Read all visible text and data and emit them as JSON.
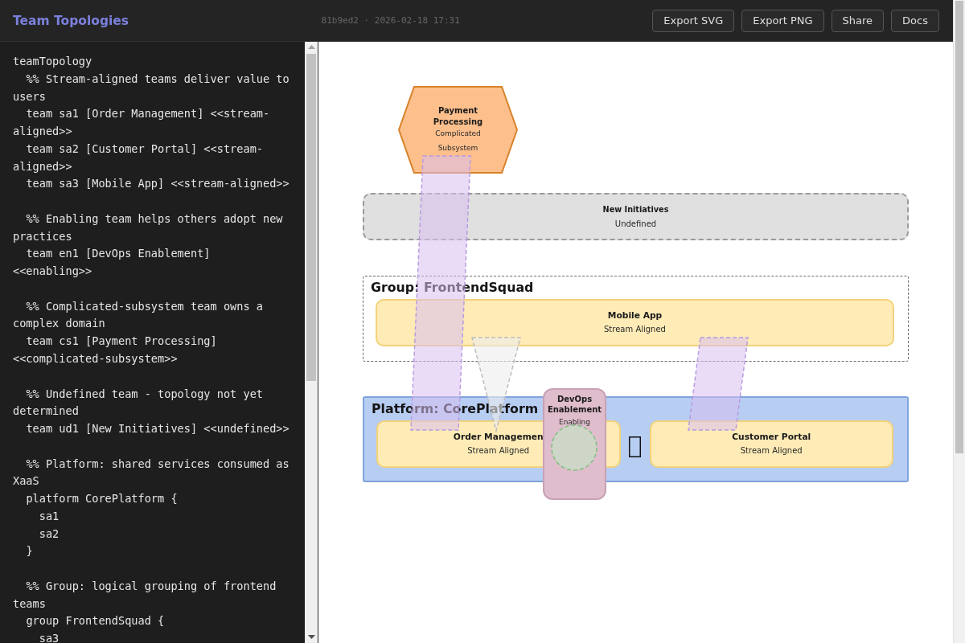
{
  "header": {
    "title": "Team Topologies",
    "version": "81b9ed2 · 2026-02-18 17:31",
    "buttons": [
      "Export SVG",
      "Export PNG",
      "Share",
      "Docs"
    ]
  },
  "editor": {
    "blocks": [
      [
        "teamTopology",
        "  %% Stream-aligned teams deliver value to users",
        "  team sa1 [Order Management] <<stream-aligned>>",
        "  team sa2 [Customer Portal] <<stream-aligned>>",
        "  team sa3 [Mobile App] <<stream-aligned>>"
      ],
      [
        "  %% Enabling team helps others adopt new practices",
        "  team en1 [DevOps Enablement] <<enabling>>"
      ],
      [
        "  %% Complicated-subsystem team owns a complex domain",
        "  team cs1 [Payment Processing] <<complicated-subsystem>>"
      ],
      [
        "  %% Undefined team - topology not yet determined",
        "  team ud1 [New Initiatives] <<undefined>>"
      ],
      [
        "  %% Platform: shared services consumed as XaaS",
        "  platform CorePlatform {",
        "    sa1",
        "    sa2",
        "  }"
      ],
      [
        "  %% Group: logical grouping of frontend teams",
        "  group FrontendSquad {",
        "    sa3"
      ]
    ]
  },
  "diagram": {
    "teams": [
      {
        "kind": "complicated-subsystem",
        "name": "Payment Processing",
        "type": "Complicated Subsystem"
      },
      {
        "kind": "undefined",
        "name": "New Initiatives",
        "type": "Undefined"
      },
      {
        "kind": "enabling",
        "name": "DevOps Enablement",
        "type": "Enabling"
      }
    ],
    "containers": [
      {
        "kind": "group",
        "label": "Group: FrontendSquad",
        "teams": [
          {
            "kind": "stream-aligned",
            "name": "Mobile App",
            "type": "Stream Aligned"
          }
        ]
      },
      {
        "kind": "platform",
        "label": "Platform: CorePlatform",
        "teams": [
          {
            "kind": "stream-aligned",
            "name": "Order Managemen",
            "type": "Stream Aligned"
          },
          {
            "kind": "stream-aligned",
            "name": "Customer Portal",
            "type": "Stream Aligned"
          }
        ]
      }
    ],
    "interactions": [
      {
        "kind": "band"
      },
      {
        "kind": "funnel"
      },
      {
        "kind": "band"
      },
      {
        "kind": "circle"
      }
    ]
  }
}
